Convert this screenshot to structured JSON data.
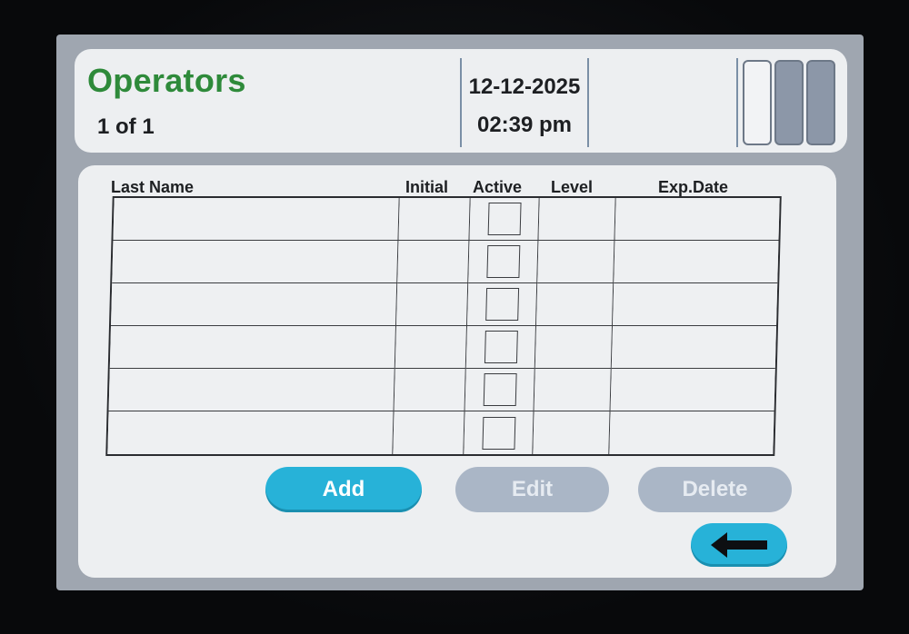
{
  "header": {
    "title": "Operators",
    "pager": "1 of 1",
    "date": "12-12-2025",
    "time": "02:39 pm",
    "battery_segments": [
      {
        "state": "empty",
        "color": "#f2f3f5"
      },
      {
        "state": "full",
        "color": "#8c97a8"
      },
      {
        "state": "full",
        "color": "#8c97a8"
      }
    ]
  },
  "table": {
    "columns": [
      "Last Name",
      "Initial",
      "Active",
      "Level",
      "Exp.Date"
    ],
    "rows": [
      {
        "last_name": "",
        "initial": "",
        "active": false,
        "level": "",
        "exp_date": ""
      },
      {
        "last_name": "",
        "initial": "",
        "active": false,
        "level": "",
        "exp_date": ""
      },
      {
        "last_name": "",
        "initial": "",
        "active": false,
        "level": "",
        "exp_date": ""
      },
      {
        "last_name": "",
        "initial": "",
        "active": false,
        "level": "",
        "exp_date": ""
      },
      {
        "last_name": "",
        "initial": "",
        "active": false,
        "level": "",
        "exp_date": ""
      },
      {
        "last_name": "",
        "initial": "",
        "active": false,
        "level": "",
        "exp_date": ""
      }
    ]
  },
  "buttons": {
    "add": {
      "label": "Add",
      "enabled": true
    },
    "edit": {
      "label": "Edit",
      "enabled": false
    },
    "delete": {
      "label": "Delete",
      "enabled": false
    },
    "back": {
      "icon": "left-arrow-icon"
    }
  },
  "colors": {
    "title_green": "#2e8a3a",
    "button_accent": "#27b2d8",
    "button_disabled": "#aab6c6",
    "panel": "#edeff1",
    "screen_frame": "#9fa6b0"
  }
}
